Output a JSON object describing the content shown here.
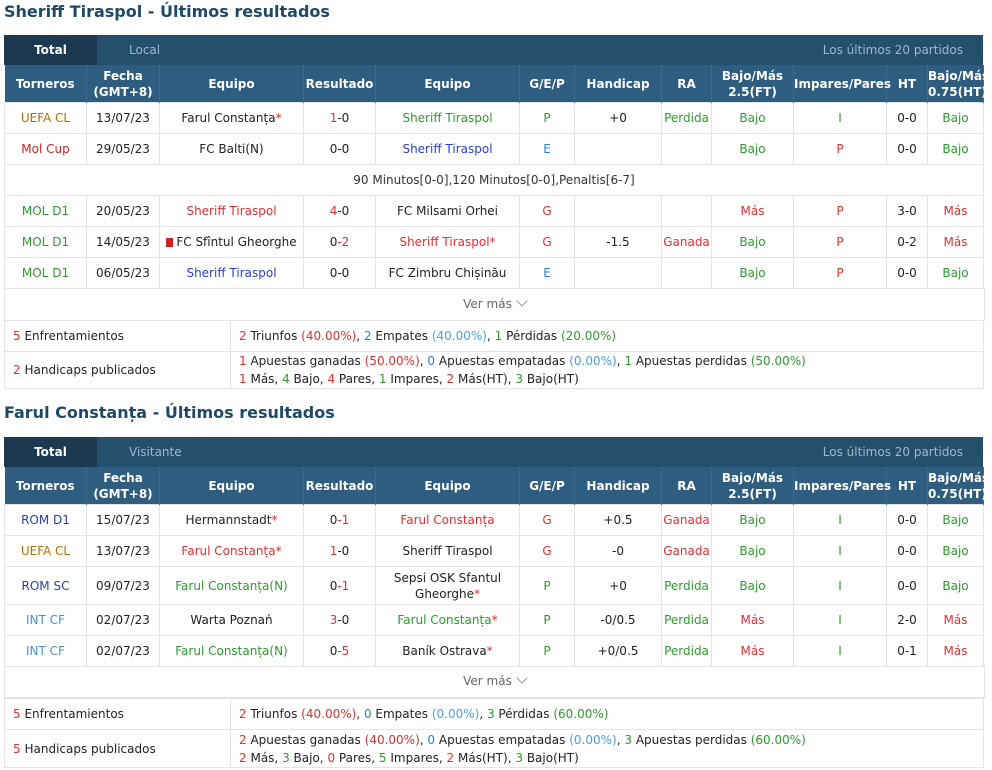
{
  "headers": [
    "Torneros",
    "Fecha\n(GMT+8)",
    "Equipo",
    "Resultado",
    "Equipo",
    "G/E/P",
    "Handicap",
    "RA",
    "Bajo/Más\n2.5(FT)",
    "Impares/Pares",
    "HT",
    "Bajo/Más\n0.75(HT)"
  ],
  "ver_mas": "Ver más",
  "colors": {
    "header_bg": "#2e5d7f",
    "tab_bg": "#244f6d",
    "win": "#2e9a2e",
    "loss": "#e03030",
    "draw": "#2d7fd0"
  },
  "sections": [
    {
      "title": "Sheriff Tiraspol - Últimos resultados",
      "tab_total": "Total",
      "tab_side": "Local",
      "tab_last": "Los últimos 20 partidos",
      "rows": [
        {
          "comp": "UEFA CL",
          "date": "13/07/23",
          "home": "Farul Constanța",
          "home_star": "*",
          "score_a": "1",
          "score_b": "-0",
          "away": "Sheriff Tiraspol",
          "away_star": "",
          "gep": "P",
          "hcap": "+0",
          "ra": "Perdida",
          "ou": "Bajo",
          "ip": "I",
          "ht": "0-0",
          "ou2": "Bajo"
        },
        {
          "comp": "Mol Cup",
          "date": "29/05/23",
          "home": "FC Balti(N)",
          "home_star": "",
          "score_a": "0",
          "score_b": "-0",
          "away": "Sheriff Tiraspol",
          "away_star": "",
          "gep": "E",
          "hcap": "",
          "ra": "",
          "ou": "Bajo",
          "ip": "P",
          "ht": "0-0",
          "ou2": "Bajo"
        },
        {
          "comp": "MOL D1",
          "date": "20/05/23",
          "home": "Sheriff Tiraspol",
          "home_star": "",
          "score_a": "4",
          "score_b": "-0",
          "away": "FC Milsami Orhei",
          "away_star": "",
          "gep": "G",
          "hcap": "",
          "ra": "",
          "ou": "Más",
          "ip": "P",
          "ht": "3-0",
          "ou2": "Más"
        },
        {
          "comp": "MOL D1",
          "date": "14/05/23",
          "home": "FC Sfîntul Gheorghe",
          "home_star": "",
          "score_a": "0",
          "score_b": "-2",
          "away": "Sheriff Tiraspol",
          "away_star": "*",
          "gep": "G",
          "hcap": "-1.5",
          "ra": "Ganada",
          "ou": "Bajo",
          "ip": "P",
          "ht": "0-2",
          "ou2": "Más"
        },
        {
          "comp": "MOL D1",
          "date": "06/05/23",
          "home": "Sheriff Tiraspol",
          "home_star": "",
          "score_a": "0",
          "score_b": "-0",
          "away": "FC Zimbru Chișinău",
          "away_star": "",
          "gep": "E",
          "hcap": "",
          "ra": "",
          "ou": "Bajo",
          "ip": "P",
          "ht": "0-0",
          "ou2": "Bajo"
        }
      ],
      "note": "90 Minutos[0-0],120 Minutos[0-0],Penaltis[6-7]",
      "summary": {
        "enf_n": "5",
        "enf_label": "Enfrentamientos",
        "wins_n": "2",
        "wins_l": "Triunfos",
        "wins_p": "(40.00%)",
        "draws_n": "2",
        "draws_l": "Empates",
        "draws_p": "(40.00%)",
        "loss_n": "1",
        "loss_l": "Pérdidas",
        "loss_p": "(20.00%)",
        "hc_n": "2",
        "hc_label": "Handicaps publicados",
        "aw_n": "1",
        "aw_l": "Apuestas ganadas",
        "aw_p": "(50.00%)",
        "ad_n": "0",
        "ad_l": "Apuestas empatadas",
        "ad_p": "(0.00%)",
        "al_n": "1",
        "al_l": "Apuestas perdidas",
        "al_p": "(50.00%)",
        "mas_n": "1",
        "mas_l": "Más,",
        "bajo_n": "4",
        "bajo_l": "Bajo,",
        "par_n": "4",
        "par_l": "Pares,",
        "imp_n": "1",
        "imp_l": "Impares,",
        "masht_n": "2",
        "masht_l": "Más(HT),",
        "bajoht_n": "3",
        "bajoht_l": "Bajo(HT)"
      }
    },
    {
      "title": "Farul Constanța - Últimos resultados",
      "tab_total": "Total",
      "tab_side": "Visitante",
      "tab_last": "Los últimos 20 partidos",
      "rows": [
        {
          "comp": "ROM D1",
          "date": "15/07/23",
          "home": "Hermannstadt",
          "home_star": "*",
          "score_a": "0",
          "score_b": "-1",
          "away": "Farul Constanța",
          "away_star": "",
          "gep": "G",
          "hcap": "+0.5",
          "ra": "Ganada",
          "ou": "Bajo",
          "ip": "I",
          "ht": "0-0",
          "ou2": "Bajo"
        },
        {
          "comp": "UEFA CL",
          "date": "13/07/23",
          "home": "Farul Constanța",
          "home_star": "*",
          "score_a": "1",
          "score_b": "-0",
          "away": "Sheriff Tiraspol",
          "away_star": "",
          "gep": "G",
          "hcap": "-0",
          "ra": "Ganada",
          "ou": "Bajo",
          "ip": "I",
          "ht": "0-0",
          "ou2": "Bajo"
        },
        {
          "comp": "ROM SC",
          "date": "09/07/23",
          "home": "Farul Constanța(N)",
          "home_star": "",
          "score_a": "0",
          "score_b": "-1",
          "away": "Sepsi OSK Sfantul Gheorghe",
          "away_star": "*",
          "gep": "P",
          "hcap": "+0",
          "ra": "Perdida",
          "ou": "Bajo",
          "ip": "I",
          "ht": "0-0",
          "ou2": "Bajo"
        },
        {
          "comp": "INT CF",
          "date": "02/07/23",
          "home": "Warta Poznań",
          "home_star": "",
          "score_a": "3",
          "score_b": "-0",
          "away": "Farul Constanța",
          "away_star": "*",
          "gep": "P",
          "hcap": "-0/0.5",
          "ra": "Perdida",
          "ou": "Más",
          "ip": "I",
          "ht": "2-0",
          "ou2": "Más"
        },
        {
          "comp": "INT CF",
          "date": "02/07/23",
          "home": "Farul Constanța(N)",
          "home_star": "",
          "score_a": "0",
          "score_b": "-5",
          "away": "Baník Ostrava",
          "away_star": "*",
          "gep": "P",
          "hcap": "+0/0.5",
          "ra": "Perdida",
          "ou": "Más",
          "ip": "I",
          "ht": "0-1",
          "ou2": "Más"
        }
      ],
      "summary": {
        "enf_n": "5",
        "enf_label": "Enfrentamientos",
        "wins_n": "2",
        "wins_l": "Triunfos",
        "wins_p": "(40.00%)",
        "draws_n": "0",
        "draws_l": "Empates",
        "draws_p": "(0.00%)",
        "loss_n": "3",
        "loss_l": "Pérdidas",
        "loss_p": "(60.00%)",
        "hc_n": "5",
        "hc_label": "Handicaps publicados",
        "aw_n": "2",
        "aw_l": "Apuestas ganadas",
        "aw_p": "(40.00%)",
        "ad_n": "0",
        "ad_l": "Apuestas empatadas",
        "ad_p": "(0.00%)",
        "al_n": "3",
        "al_l": "Apuestas perdidas",
        "al_p": "(60.00%)",
        "mas_n": "2",
        "mas_l": "Más,",
        "bajo_n": "3",
        "bajo_l": "Bajo,",
        "par_n": "0",
        "par_l": "Pares,",
        "imp_n": "5",
        "imp_l": "Impares,",
        "masht_n": "2",
        "masht_l": "Más(HT),",
        "bajoht_n": "3",
        "bajoht_l": "Bajo(HT)"
      }
    }
  ]
}
